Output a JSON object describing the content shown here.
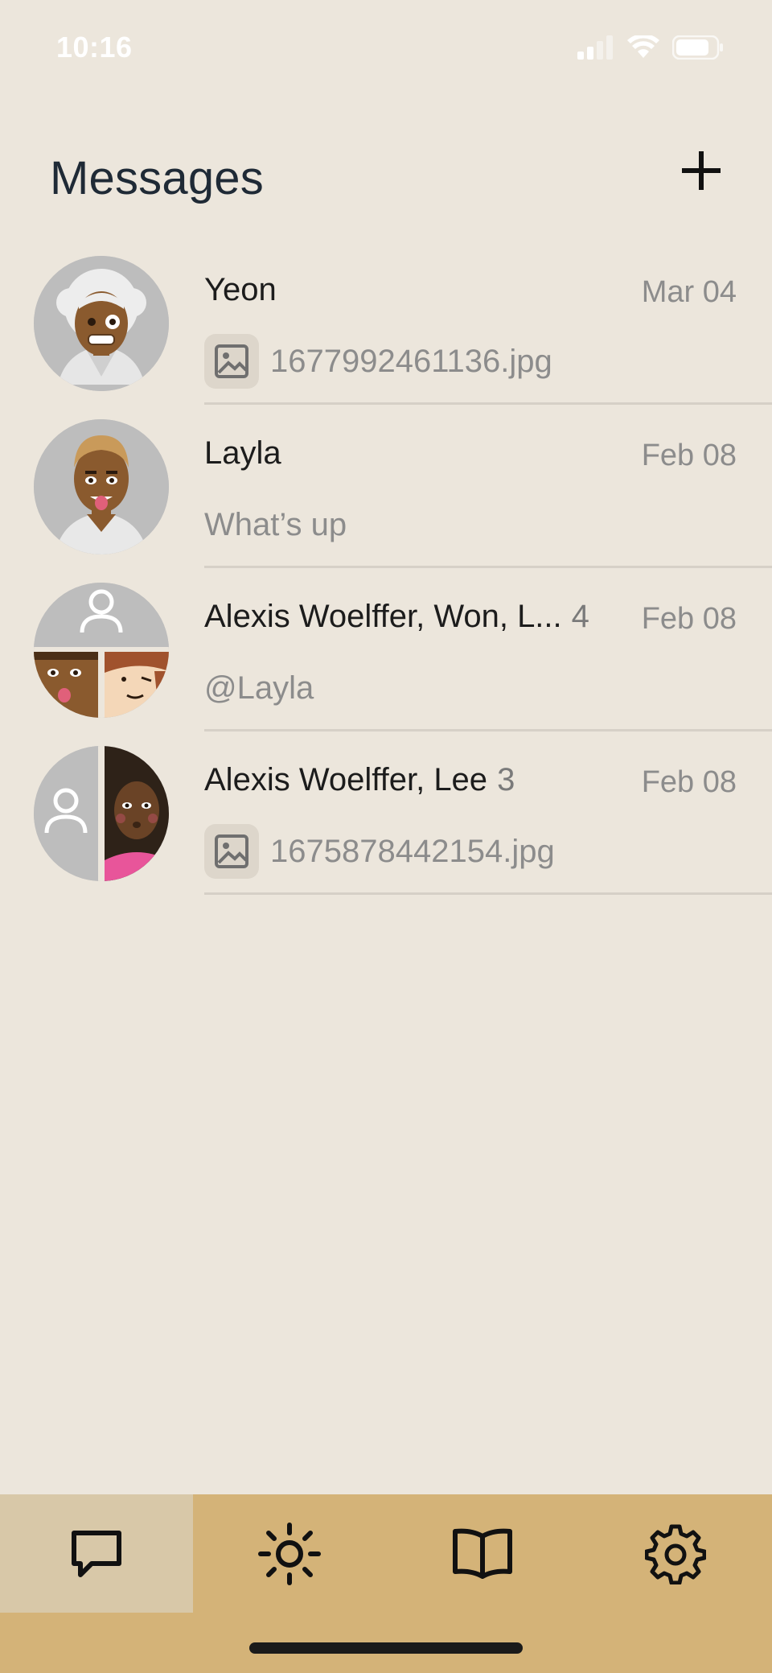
{
  "status_bar": {
    "time": "10:16"
  },
  "header": {
    "title": "Messages"
  },
  "conversations": [
    {
      "name": "Yeon",
      "count": "",
      "date": "Mar 04",
      "preview": "1677992461136.jpg",
      "preview_type": "image"
    },
    {
      "name": "Layla",
      "count": "",
      "date": "Feb 08",
      "preview": "What’s up",
      "preview_type": "text"
    },
    {
      "name": "Alexis Woelffer, Won, L...",
      "count": "4",
      "date": "Feb 08",
      "preview": "@Layla",
      "preview_type": "text"
    },
    {
      "name": "Alexis Woelffer, Lee",
      "count": "3",
      "date": "Feb 08",
      "preview": "1675878442154.jpg",
      "preview_type": "image"
    }
  ],
  "tabs": [
    {
      "icon": "chat-bubble-icon",
      "active": true
    },
    {
      "icon": "sun-icon",
      "active": false
    },
    {
      "icon": "book-icon",
      "active": false
    },
    {
      "icon": "gear-icon",
      "active": false
    }
  ],
  "colors": {
    "background": "#ece6dc",
    "tab_bar": "#d4b378",
    "tab_active": "#d8c8a8",
    "title": "#1f2a36"
  }
}
